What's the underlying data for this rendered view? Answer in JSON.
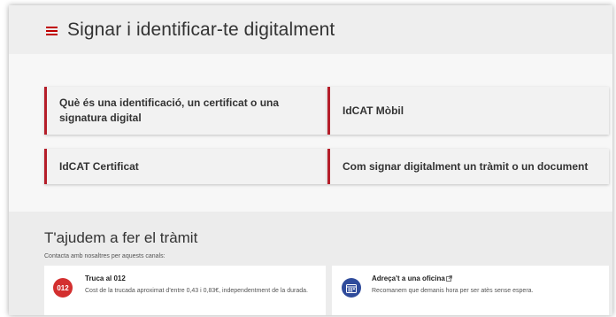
{
  "header": {
    "title": "Signar i identificar-te digitalment",
    "menu_icon": "hamburger-menu-icon",
    "accent_color": "#c00000"
  },
  "cards": [
    {
      "label": "Què és una identificació, un certificat o una signatura digital"
    },
    {
      "label": "IdCAT Mòbil"
    },
    {
      "label": "IdCAT Certificat"
    },
    {
      "label": "Com signar digitalment un tràmit o un document"
    }
  ],
  "help": {
    "title": "T'ajudem a fer el tràmit",
    "subtitle": "Contacta amb nosaltres per aquests canals:",
    "channels": [
      {
        "icon": "phone-012-icon",
        "badge": "012",
        "title": "Truca al 012",
        "description": "Cost de la trucada aproximat d'entre 0,43 i 0,83€, independentment de la durada."
      },
      {
        "icon": "office-calendar-icon",
        "title": "Adreça't a una oficina",
        "link_icon": "external-link-icon",
        "description": "Recomanem que demanis hora per ser atès sense espera."
      }
    ]
  },
  "colors": {
    "card_border": "#b51e2a",
    "badge_red": "#d32f2f",
    "badge_blue": "#2f4b9b"
  }
}
